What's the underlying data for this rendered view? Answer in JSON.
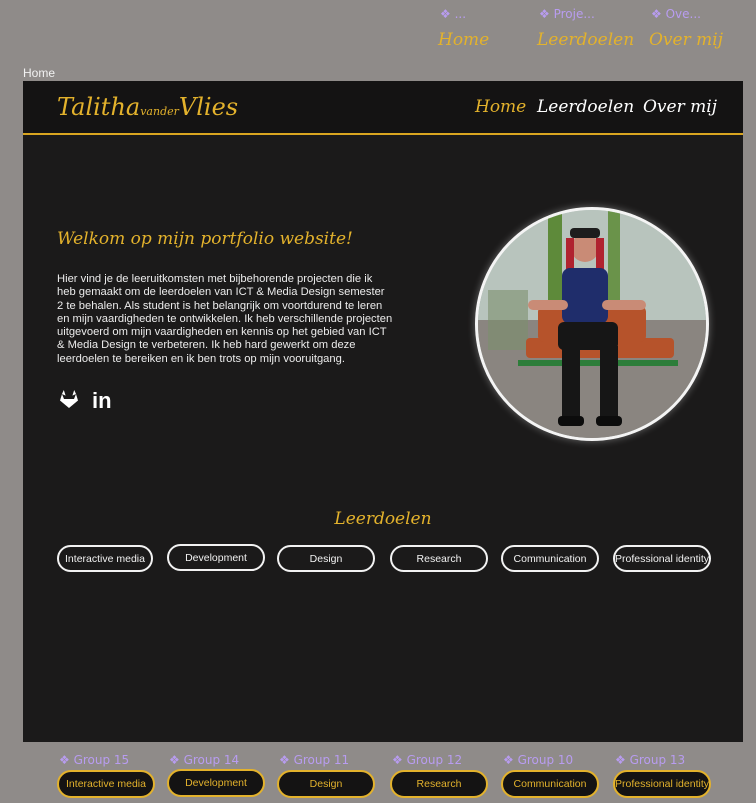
{
  "top_components": [
    {
      "tag": "❖ ...",
      "link": "Home"
    },
    {
      "tag": "❖ Proje...",
      "link": "Leerdoelen"
    },
    {
      "tag": "❖ Ove...",
      "link": "Over mij"
    }
  ],
  "frame_label": "Home",
  "header": {
    "logo_first": "Talitha",
    "logo_middle": "vander",
    "logo_last": "Vlies",
    "nav": [
      "Home",
      "Leerdoelen",
      "Over mij"
    ]
  },
  "hero": {
    "welcome": "Welkom op mijn portfolio website!",
    "intro": "Hier vind je de leeruitkomsten met bijbehorende projecten die ik heb gemaakt om de leerdoelen van ICT & Media Design semester 2 te behalen. Als student is het belangrijk om voortdurend te leren en mijn vaardigheden te ontwikkelen. Ik heb verschillende projecten uitgevoerd om mijn vaardigheden en kennis op het gebied van ICT & Media Design te verbeteren. Ik heb hard gewerkt om deze leerdoelen te bereiken en ik ben trots op mijn vooruitgang.",
    "social": [
      "gitlab-icon",
      "linkedin-icon"
    ],
    "social_text": {
      "linkedin": "in"
    }
  },
  "leerdoelen": {
    "title": "Leerdoelen",
    "items": [
      "Interactive media",
      "Development",
      "Design",
      "Research",
      "Communication",
      "Professional identity"
    ]
  },
  "groups": [
    {
      "tag": "❖ Group 15",
      "label": "Interactive media"
    },
    {
      "tag": "❖ Group 14",
      "label": "Development"
    },
    {
      "tag": "❖ Group 11",
      "label": "Design"
    },
    {
      "tag": "❖ Group 12",
      "label": "Research"
    },
    {
      "tag": "❖ Group 10",
      "label": "Communication"
    },
    {
      "tag": "❖ Group 13",
      "label": "Professional identity"
    }
  ],
  "colors": {
    "accent": "#e3b22c",
    "background": "#1b1a1a",
    "canvas": "#8f8b89",
    "component_tag": "#b89cf0"
  }
}
